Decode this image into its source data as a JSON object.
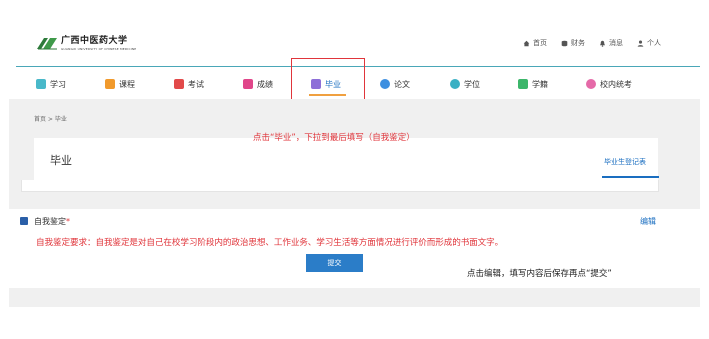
{
  "header": {
    "logo_cn": "广西中医药大学",
    "logo_en": "GUANGXI UNIVERSITY OF CHINESE MEDICINE",
    "links": [
      {
        "label": "首页",
        "icon": "home-icon"
      },
      {
        "label": "财务",
        "icon": "database-icon"
      },
      {
        "label": "消息",
        "icon": "bell-icon"
      },
      {
        "label": "个人",
        "icon": "user-icon"
      }
    ],
    "accent": "#4aa7b8"
  },
  "nav": {
    "items": [
      {
        "label": "学习",
        "icon": "study-icon",
        "color": "#49b8c9"
      },
      {
        "label": "课程",
        "icon": "course-icon",
        "color": "#f19a2c"
      },
      {
        "label": "考试",
        "icon": "exam-icon",
        "color": "#e24a4a"
      },
      {
        "label": "成绩",
        "icon": "score-icon",
        "color": "#e0468a"
      },
      {
        "label": "毕业",
        "icon": "graduation-icon",
        "color": "#8d6fd8"
      },
      {
        "label": "论文",
        "icon": "thesis-icon",
        "color": "#3d8fe0"
      },
      {
        "label": "学位",
        "icon": "degree-icon",
        "color": "#3ab0c4"
      },
      {
        "label": "学籍",
        "icon": "registry-icon",
        "color": "#3cb66a"
      },
      {
        "label": "校内统考",
        "icon": "unified-exam-icon",
        "color": "#e56aa8"
      }
    ],
    "active": "毕业",
    "active_underline_color": "#f0a040"
  },
  "breadcrumb": {
    "home": "首页",
    "sep": " > ",
    "current": "毕业"
  },
  "annotations": {
    "instruction_top": "点击“毕业”，下拉到最后填写（自我鉴定）",
    "requirement": "自我鉴定要求：自我鉴定是对自己在校学习阶段内的政治思想、工作业务、学习生活等方面情况进行评价而形成的书面文字。",
    "note_bottom": "点击编辑，填写内容后保存再点“提交”",
    "highlight_color": "#e0353b"
  },
  "card": {
    "title": "毕业",
    "tab": "毕业生登记表"
  },
  "self_assessment": {
    "title": "自我鉴定",
    "required_mark": "*",
    "edit_label": "编辑",
    "submit_label": "提交"
  },
  "colors": {
    "link_blue": "#1a6ec0",
    "button_blue": "#2b7dc8",
    "background_grey": "#f0f0f0"
  }
}
